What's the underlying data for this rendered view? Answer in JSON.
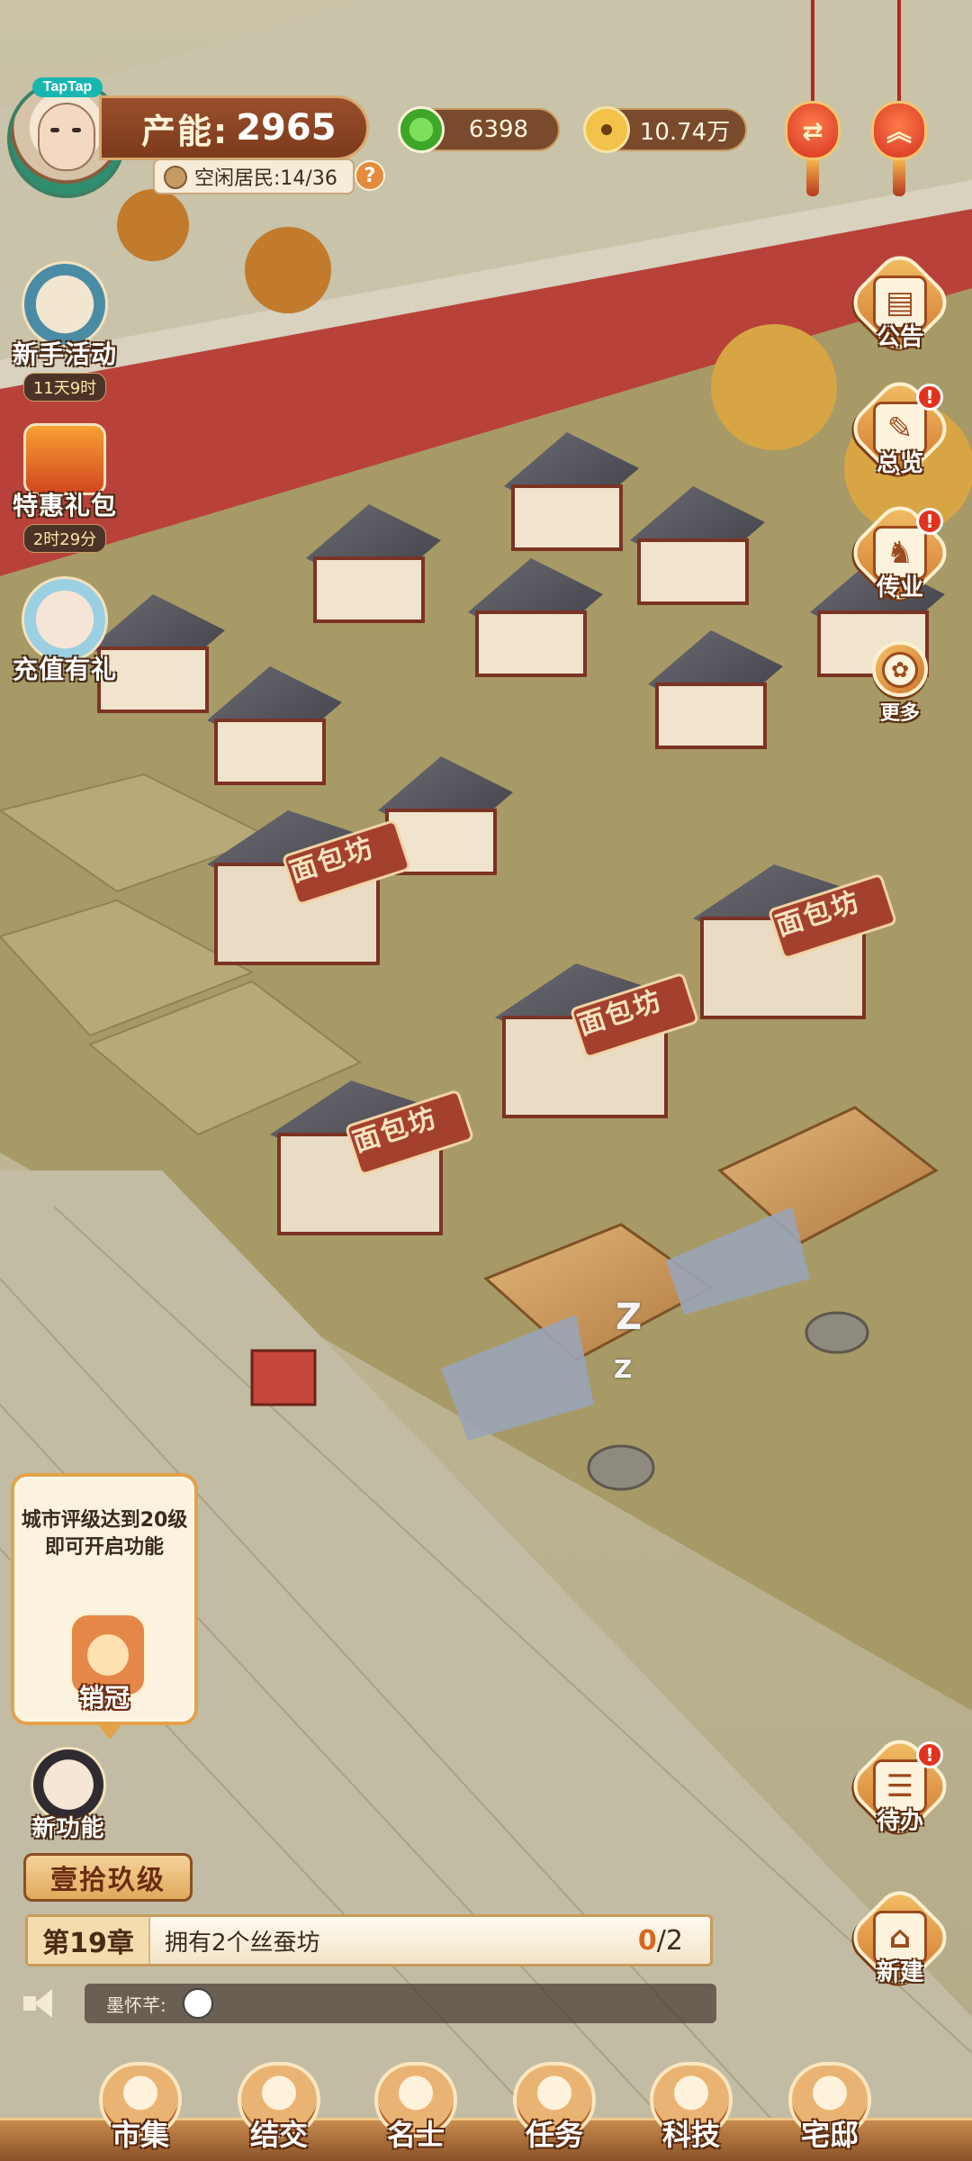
{
  "player": {
    "avatar_badge": "TapTap",
    "production_label": "产能:",
    "production_value": "2965",
    "idle_residents": "空闲居民:14/36",
    "help": "?"
  },
  "currencies": {
    "jade": "6398",
    "coins": "10.74万"
  },
  "lanterns": [
    "swap-lantern",
    "collapse-lantern"
  ],
  "left_buttons": {
    "newbie_event": {
      "label": "新手活动",
      "timer": "11天9时"
    },
    "special_pack": {
      "label": "特惠礼包",
      "timer": "2时29分"
    },
    "recharge_gift": {
      "label": "充值有礼"
    }
  },
  "right_buttons": {
    "notice": {
      "label": "公告",
      "glyph": "▤"
    },
    "overview": {
      "label": "总览",
      "glyph": "✎",
      "alert": "!"
    },
    "inherit": {
      "label": "传业",
      "glyph": "♞",
      "alert": "!"
    },
    "more": {
      "label": "更多",
      "glyph": "✿"
    },
    "todo": {
      "label": "待办",
      "glyph": "☰",
      "alert": "!"
    },
    "build": {
      "label": "新建",
      "glyph": "⌂"
    }
  },
  "buildings": {
    "bakery_sign": "面包坊",
    "sleep_marks": [
      "Z",
      "Z"
    ]
  },
  "locked_feature": {
    "line1": "城市评级达到20级",
    "line2": "即可开启功能",
    "name": "销冠"
  },
  "new_feature": {
    "label": "新功能"
  },
  "chapter": {
    "level_badge": "壹拾玖级",
    "chapter_label": "第19章",
    "task": "拥有2个丝蚕坊",
    "progress_current": "0",
    "progress_total": "/2"
  },
  "chat": {
    "speaker": "墨怀芊:"
  },
  "bottom_nav": [
    {
      "label": "市集"
    },
    {
      "label": "结交"
    },
    {
      "label": "名士"
    },
    {
      "label": "任务"
    },
    {
      "label": "科技"
    },
    {
      "label": "宅邸"
    }
  ],
  "colors": {
    "ground": "#a9a17a",
    "wall_red": "#b8423a",
    "accent_orange": "#d2742c",
    "hud_brown": "#7c3a1c"
  }
}
